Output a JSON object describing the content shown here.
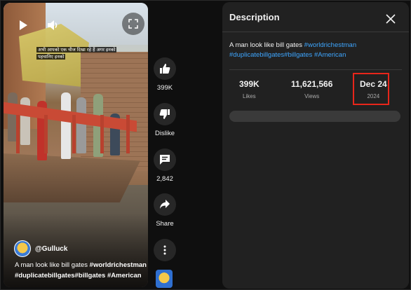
{
  "player": {
    "overlay_caption_line1": "अभी आपको एक चीज दिखा रहे हैं अगर इनको",
    "overlay_caption_line2": "पहचानिए इनको",
    "channel_name": "@Gulluck",
    "title_text": "A man look like bill gates ",
    "title_tags": "#worldrichestman #duplicatebillgates#billgates #American",
    "icons": [
      "play-icon",
      "volume-icon",
      "fullscreen-icon"
    ]
  },
  "actions": {
    "like_count": "399K",
    "dislike_label": "Dislike",
    "comment_count": "2,842",
    "share_label": "Share"
  },
  "description_panel": {
    "title": "Description",
    "text": "A man look like bill gates ",
    "hashtag_1": "#worldrichestman",
    "hashtag_2": "#duplicatebillgates",
    "hashtag_3": "#billgates",
    "hashtag_4": "#American",
    "stats": [
      {
        "value": "399K",
        "label": "Likes"
      },
      {
        "value": "11,621,566",
        "label": "Views"
      },
      {
        "value": "Dec 24",
        "label": "2024"
      }
    ]
  },
  "colors": {
    "background": "#0f0f0f",
    "panel": "#212121",
    "hashtag": "#3ea6ff",
    "highlight": "#e8261a"
  }
}
